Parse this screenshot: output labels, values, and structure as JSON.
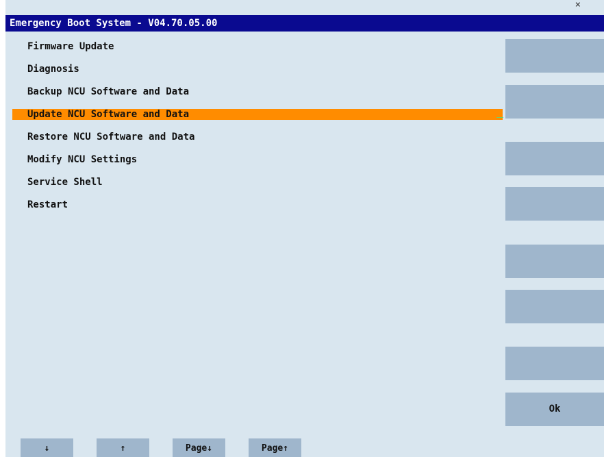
{
  "window": {
    "title": "Emergency Boot System - V04.70.05.00",
    "corner_mark": "×"
  },
  "menu": {
    "items": [
      {
        "label": "Firmware Update",
        "selected": false
      },
      {
        "label": "Diagnosis",
        "selected": false
      },
      {
        "label": "Backup NCU Software and Data",
        "selected": false
      },
      {
        "label": "Update NCU Software and Data",
        "selected": true
      },
      {
        "label": "Restore NCU Software and Data",
        "selected": false
      },
      {
        "label": "Modify NCU Settings",
        "selected": false
      },
      {
        "label": "Service Shell",
        "selected": false
      },
      {
        "label": "Restart",
        "selected": false
      }
    ]
  },
  "softkeys": {
    "vertical": [
      "",
      "",
      "",
      "",
      "",
      "",
      "",
      "Ok"
    ],
    "horizontal": [
      "↓",
      "↑",
      "Page↓",
      "Page↑"
    ]
  },
  "colors": {
    "background": "#d9e6ef",
    "titlebar": "#0a0a90",
    "selection": "#ff8c00",
    "softkey": "#9fb6cc"
  }
}
